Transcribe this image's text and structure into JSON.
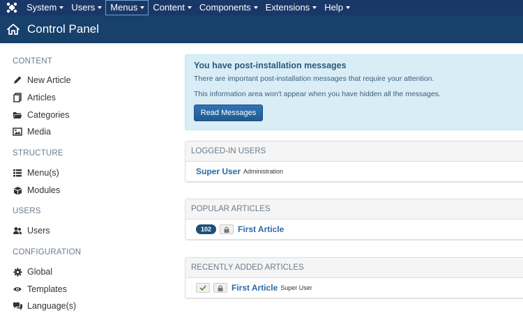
{
  "navbar": {
    "menus": [
      {
        "label": "System",
        "active": false
      },
      {
        "label": "Users",
        "active": false
      },
      {
        "label": "Menus",
        "active": true
      },
      {
        "label": "Content",
        "active": false
      },
      {
        "label": "Components",
        "active": false
      },
      {
        "label": "Extensions",
        "active": false
      },
      {
        "label": "Help",
        "active": false
      }
    ]
  },
  "header": {
    "title": "Control Panel"
  },
  "sidebar": {
    "sections": [
      {
        "title": "CONTENT",
        "items": [
          {
            "label": "New Article",
            "icon": "pencil-icon"
          },
          {
            "label": "Articles",
            "icon": "copy-icon"
          },
          {
            "label": "Categories",
            "icon": "folder-icon"
          },
          {
            "label": "Media",
            "icon": "image-icon"
          }
        ]
      },
      {
        "title": "STRUCTURE",
        "items": [
          {
            "label": "Menu(s)",
            "icon": "list-icon"
          },
          {
            "label": "Modules",
            "icon": "cube-icon"
          }
        ]
      },
      {
        "title": "USERS",
        "items": [
          {
            "label": "Users",
            "icon": "users-icon"
          }
        ]
      },
      {
        "title": "CONFIGURATION",
        "items": [
          {
            "label": "Global",
            "icon": "gear-icon"
          },
          {
            "label": "Templates",
            "icon": "eye-icon"
          },
          {
            "label": "Language(s)",
            "icon": "comments-icon"
          }
        ]
      }
    ]
  },
  "alert": {
    "title": "You have post-installation messages",
    "line1": "There are important post-installation messages that require your attention.",
    "line2": "This information area won't appear when you have hidden all the messages.",
    "button": "Read Messages"
  },
  "logged_in": {
    "title": "LOGGED-IN USERS",
    "user": "Super User",
    "area": "Administration"
  },
  "popular": {
    "title": "POPULAR ARTICLES",
    "hits": "102",
    "article": "First Article"
  },
  "recent": {
    "title": "RECENTLY ADDED ARTICLES",
    "article": "First Article",
    "author": "Super User"
  },
  "colors": {
    "navbar": "#1a3867",
    "header": "#17406b",
    "link": "#2a6aa6",
    "alert_bg": "#d9edf7"
  }
}
